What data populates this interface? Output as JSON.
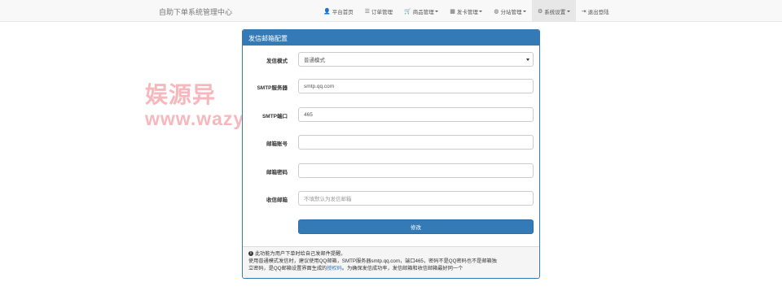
{
  "navbar": {
    "brand": "自助下单系统管理中心",
    "items": [
      {
        "label": "平台首页",
        "icon": "user-icon",
        "glyph": "👤"
      },
      {
        "label": "订单管理",
        "icon": "list-icon",
        "glyph": "☰"
      },
      {
        "label": "商品管理",
        "icon": "cart-icon",
        "glyph": "🛒",
        "dropdown": true
      },
      {
        "label": "发卡管理",
        "icon": "grid-icon",
        "glyph": "▦",
        "dropdown": true
      },
      {
        "label": "分站管理",
        "icon": "globe-icon",
        "glyph": "◍",
        "dropdown": true
      },
      {
        "label": "系统设置",
        "icon": "gear-icon",
        "glyph": "⚙",
        "dropdown": true,
        "active": true
      },
      {
        "label": "退出登陆",
        "icon": "logout-icon",
        "glyph": "⇥"
      }
    ]
  },
  "panel": {
    "title": "发信邮箱配置",
    "fields": {
      "mode": {
        "label": "发信模式",
        "value": "普通模式"
      },
      "smtp_server": {
        "label": "SMTP服务器",
        "value": "smtp.qq.com"
      },
      "smtp_port": {
        "label": "SMTP端口",
        "value": "465"
      },
      "account": {
        "label": "邮箱账号",
        "value": ""
      },
      "password": {
        "label": "邮箱密码",
        "value": ""
      },
      "receiver": {
        "label": "收信邮箱",
        "value": "",
        "placeholder": "不填默认为发信邮箱"
      }
    },
    "submit_label": "修改",
    "footer": {
      "line1": "此功能为用户下单时给自己发邮件提醒。",
      "line2": "使用普通模式发信时，建议使用QQ邮箱，SMTP服务器smtp.qq.com，端口465，密码不是QQ密码也不是邮箱独",
      "line3_pre": "立密码，是QQ邮箱设置界面生成的",
      "line3_link": "授权码",
      "line3_post": "。为确保发信成功率，发信邮箱和收信邮箱最好同一个"
    }
  },
  "watermark": {
    "logo": "娱源异",
    "url": "www.wazyb.com"
  },
  "colors": {
    "primary": "#337ab7",
    "navbar_bg": "#f8f8f8",
    "watermark": "#f5a0a6"
  }
}
